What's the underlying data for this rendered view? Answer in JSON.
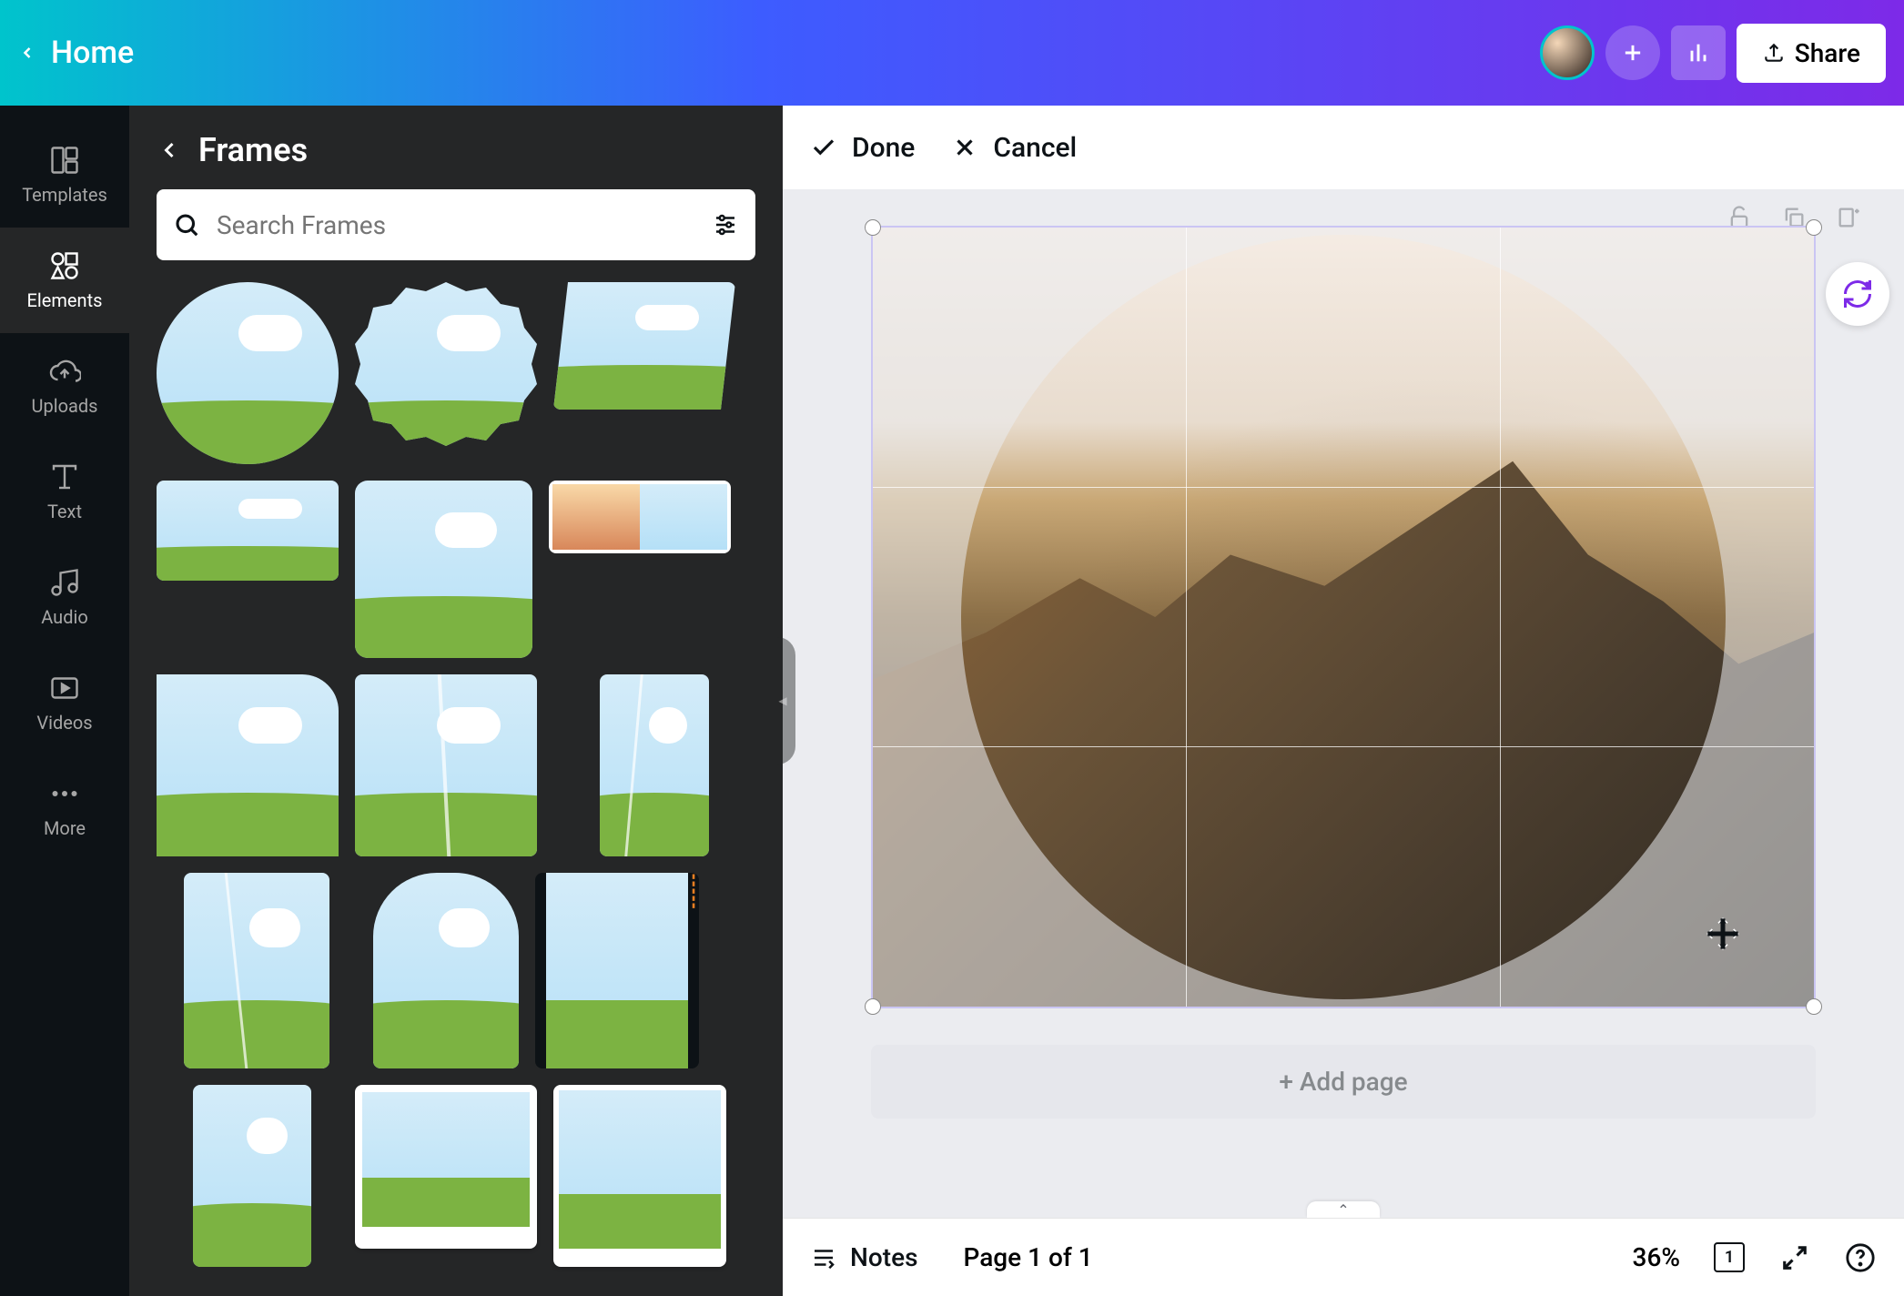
{
  "header": {
    "home_label": "Home",
    "share_label": "Share"
  },
  "nav": {
    "items": [
      {
        "label": "Templates",
        "icon": "templates"
      },
      {
        "label": "Elements",
        "icon": "elements"
      },
      {
        "label": "Uploads",
        "icon": "uploads"
      },
      {
        "label": "Text",
        "icon": "text"
      },
      {
        "label": "Audio",
        "icon": "audio"
      },
      {
        "label": "Videos",
        "icon": "videos"
      },
      {
        "label": "More",
        "icon": "more"
      }
    ],
    "active_index": 1
  },
  "side_panel": {
    "title": "Frames",
    "search_placeholder": "Search Frames"
  },
  "toolbar": {
    "done_label": "Done",
    "cancel_label": "Cancel"
  },
  "canvas": {
    "add_page_label": "+ Add page"
  },
  "bottom": {
    "notes_label": "Notes",
    "page_indicator": "Page 1 of 1",
    "zoom_level": "36%",
    "page_count": "1"
  },
  "colors": {
    "accent_teal": "#00c4cc",
    "accent_purple": "#7d2ae8",
    "selection": "#a394f5",
    "panel_bg": "#252627",
    "rail_bg": "#0d1216"
  }
}
